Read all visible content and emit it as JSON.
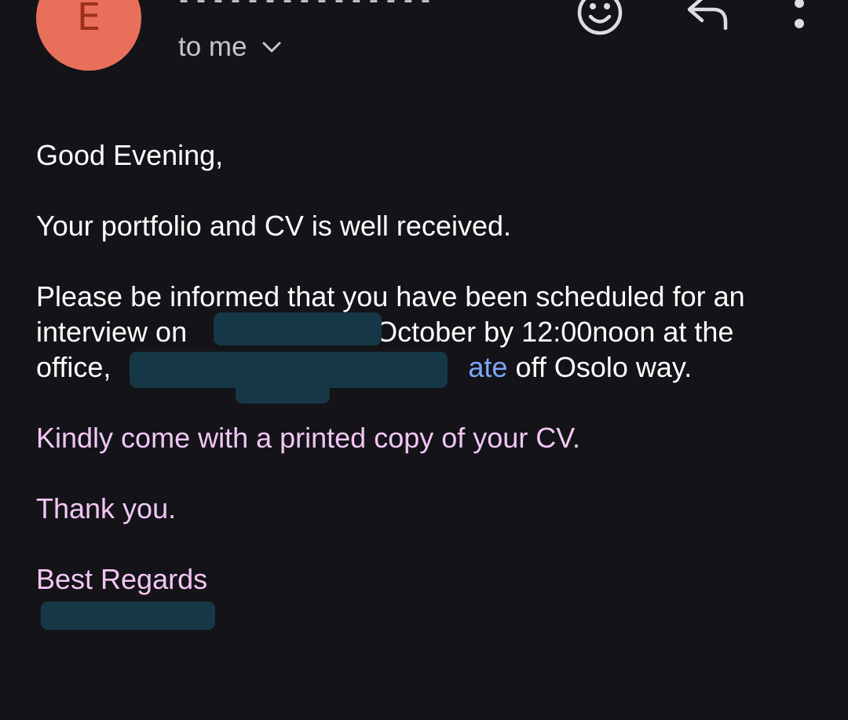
{
  "header": {
    "avatar_letter": "E",
    "sender_line": "- - - - - - - - - - - - - - -",
    "recipient_label": "to me",
    "icons": {
      "emoji": "emoji-reaction-icon",
      "reply": "reply-icon",
      "more": "more-vert-icon",
      "chevron": "chevron-down-icon"
    }
  },
  "message": {
    "greeting": "Good Evening,",
    "line1": "Your portfolio and CV is well received.",
    "para2_line1": "Please be informed that you have been scheduled for an",
    "para2_line2_prefix": "interview on",
    "para2_line2_suffix": "October by 12:00noon at the",
    "para2_line3_prefix": "office,",
    "para2_line3_link": "ate",
    "para2_line3_suffix": "off Osolo way.",
    "kindly": "Kindly come with a printed copy of your CV.",
    "thanks": "Thank you.",
    "regards": "Best Regards"
  },
  "colors": {
    "background": "#131318",
    "avatar": "#e8705b",
    "pink_text": "#f2c6f4",
    "link": "#7ea6f7",
    "redaction": "#163846"
  }
}
